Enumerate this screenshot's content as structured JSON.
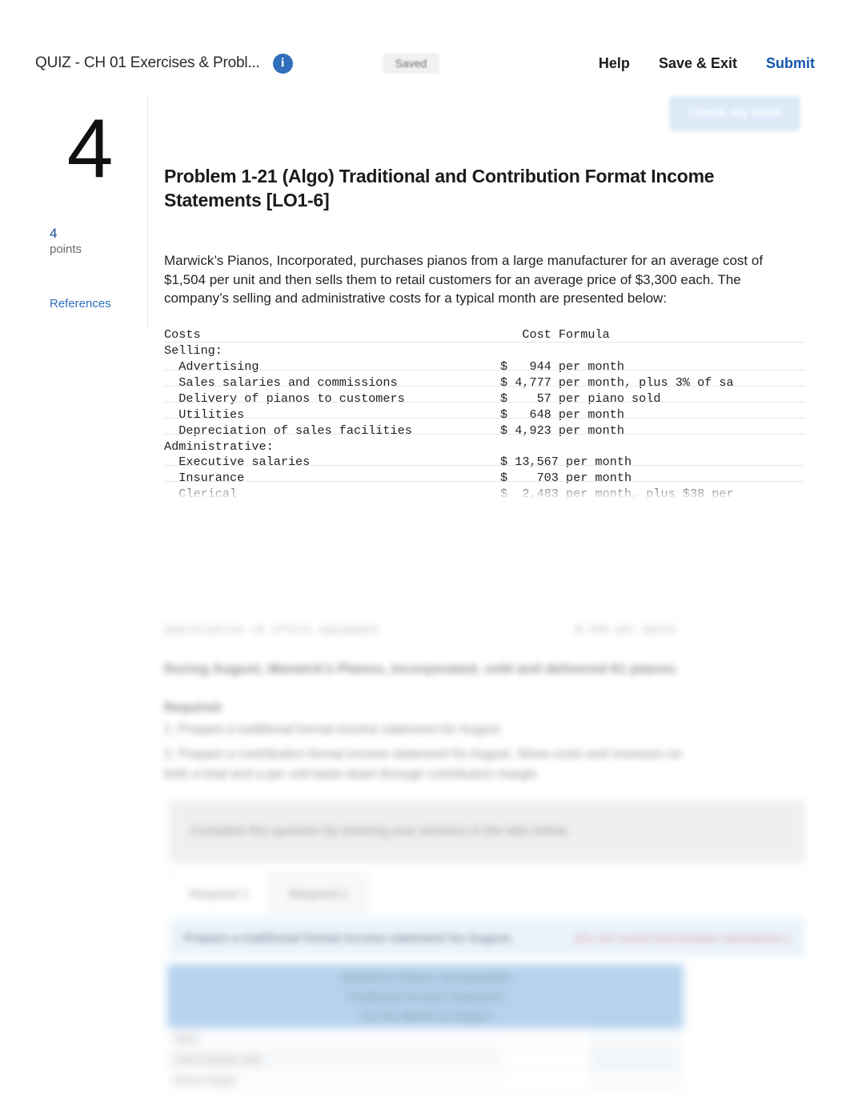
{
  "topbar": {
    "quiz_title": "QUIZ - CH 01 Exercises & Probl...",
    "info_icon": "info-icon",
    "saved_status": "Saved",
    "help_label": "Help",
    "save_exit_label": "Save & Exit",
    "submit_label": "Submit"
  },
  "check_my_work": {
    "label": "Check my work"
  },
  "left_rail": {
    "question_number": "4",
    "points_value": "4",
    "points_label": "points",
    "references_label": "References"
  },
  "problem": {
    "title": "Problem 1-21 (Algo) Traditional and Contribution Format Income Statements [LO1-6]",
    "body": "Marwick’s Pianos, Incorporated, purchases pianos from a large manufacturer for an average cost of $1,504 per unit and then sells them to retail customers for an average price of $3,300 each. The company’s selling and administrative costs for a typical month are presented below:"
  },
  "cost_table": {
    "col_costs": "Costs",
    "col_formula": "Cost Formula",
    "rows": [
      {
        "label": "Selling:",
        "value": "",
        "indent": 0
      },
      {
        "label": "Advertising",
        "value": "$   944 per month",
        "indent": 1
      },
      {
        "label": "Sales salaries and commissions",
        "value": "$ 4,777 per month, plus 3% of sa",
        "indent": 1
      },
      {
        "label": "Delivery of pianos to customers",
        "value": "$    57 per piano sold",
        "indent": 1
      },
      {
        "label": "Utilities",
        "value": "$   648 per month",
        "indent": 1
      },
      {
        "label": "Depreciation of sales facilities",
        "value": "$ 4,923 per month",
        "indent": 1
      },
      {
        "label": "Administrative:",
        "value": "",
        "indent": 0
      },
      {
        "label": "Executive salaries",
        "value": "$ 13,567 per month",
        "indent": 1
      },
      {
        "label": "Insurance",
        "value": "$    703 per month",
        "indent": 1
      },
      {
        "label": "Clerical",
        "value": "$  2,483 per month, plus $38 per",
        "indent": 1
      }
    ]
  },
  "lower_blurred": {
    "ghost_row_label": "Depreciation of office equipment",
    "ghost_row_value": "$ 940 per month",
    "note": "During August, Marwick’s Pianos, Incorporated, sold and delivered 61 pianos.",
    "required_label": "Required:",
    "required_items": [
      "1. Prepare a traditional format income statement for August.",
      "2. Prepare a contribution format income statement for August. Show costs and revenues on both a total and a per unit basis down through contribution margin."
    ],
    "answer_prompt": "Complete this question by entering your answers in the tabs below.",
    "tabs": [
      {
        "label": "Required 1"
      },
      {
        "label": "Required 2"
      }
    ],
    "requirement_band": "Prepare a traditional format income statement for August.",
    "requirement_warning": "(Do not round intermediate calculations.)",
    "sheet_header": [
      "Marwick's Pianos, Incorporated",
      "Traditional Income Statement",
      "For the Month of August"
    ],
    "sheet_rows": [
      {
        "c1": "Sales",
        "c3": ""
      },
      {
        "c1": "Cost of goods sold",
        "c3": ""
      },
      {
        "c1": "Gross margin",
        "c3": ""
      }
    ]
  },
  "colors": {
    "accent_blue": "#1256ad",
    "info_blue": "#2f6fbc",
    "sheet_header_blue": "#6ea8de",
    "band_blue": "#daeaf7",
    "warning_red": "#c05060"
  }
}
